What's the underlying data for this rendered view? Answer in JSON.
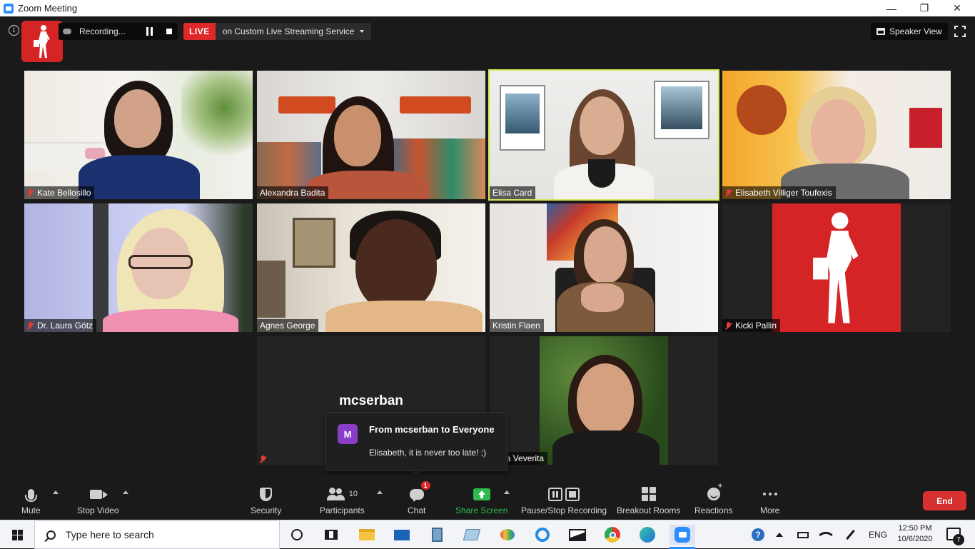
{
  "window": {
    "title": "Zoom Meeting",
    "minimize": "—",
    "restore": "❐",
    "close": "✕"
  },
  "top_bar": {
    "recording_label": "Recording...",
    "live_label": "LIVE",
    "live_service": "on Custom Live Streaming Service",
    "view_label": "Speaker View"
  },
  "participants": [
    {
      "name": "Kate Bellosillo",
      "muted": true
    },
    {
      "name": "Alexandra Badita",
      "muted": false
    },
    {
      "name": "Elisa Card",
      "muted": false,
      "active": true
    },
    {
      "name": "Elisabeth Villiger Toufexis",
      "muted": true
    },
    {
      "name": "Dr. Laura Götz",
      "muted": true
    },
    {
      "name": "Agnes George",
      "muted": false
    },
    {
      "name": "Kristin Flaen",
      "muted": false
    },
    {
      "name": "Kicki Pallin",
      "muted": true
    },
    {
      "name": "mcserban",
      "muted": true,
      "video": false
    },
    {
      "name": "Gina Veverita",
      "muted": false
    }
  ],
  "chat_notification": {
    "avatar_letter": "M",
    "from": "From mcserban to Everyone",
    "message": "Elisabeth, it is never too late! ;)"
  },
  "toolbar": {
    "mute": "Mute",
    "stop_video": "Stop Video",
    "security": "Security",
    "participants": "Participants",
    "participants_count": "10",
    "chat": "Chat",
    "chat_badge": "1",
    "share_screen": "Share Screen",
    "pause_stop_recording": "Pause/Stop Recording",
    "breakout_rooms": "Breakout Rooms",
    "reactions": "Reactions",
    "more": "More",
    "end": "End"
  },
  "taskbar": {
    "search_placeholder": "Type here to search",
    "language": "ENG",
    "time": "12:50 PM",
    "date": "10/6/2020",
    "notification_count": "7"
  },
  "colors": {
    "active_speaker_border": "#d8e85a",
    "live_red": "#e02828",
    "share_green": "#2dbb4e",
    "end_red": "#d63030",
    "brand_red": "#d42426"
  }
}
